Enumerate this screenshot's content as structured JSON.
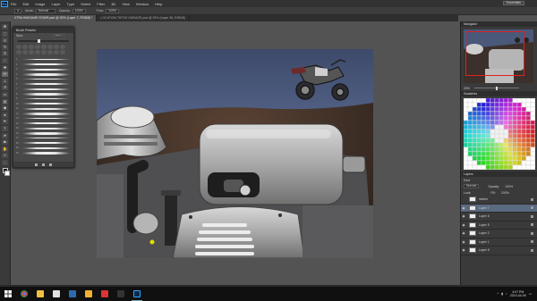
{
  "app": {
    "logo_text": "Ps"
  },
  "menu": [
    "File",
    "Edit",
    "Image",
    "Layer",
    "Type",
    "Select",
    "Filter",
    "3D",
    "View",
    "Window",
    "Help"
  ],
  "workspace_button": "Essentials",
  "options": {
    "mode_label": "Mode:",
    "mode_value": "Normal",
    "opacity_label": "Opacity:",
    "opacity_value": "100%",
    "flow_label": "Flow:",
    "flow_value": "100%"
  },
  "tabs": [
    {
      "label": "XTRA INHGAME ROWR.psd @ 33% (Layer 7, RGB/8) *",
      "active": true
    },
    {
      "label": "LOCATION TATOO GARAGE.psd @ 33% (Layer 36, RGB/8)",
      "active": false
    }
  ],
  "tools": [
    "move-icon",
    "marquee-icon",
    "lasso-icon",
    "quick-select-icon",
    "crop-icon",
    "eyedropper-icon",
    "spot-heal-icon",
    "brush-icon",
    "clone-stamp-icon",
    "history-brush-icon",
    "eraser-icon",
    "gradient-icon",
    "blur-icon",
    "dodge-icon",
    "pen-icon",
    "type-icon",
    "path-select-icon",
    "rectangle-icon",
    "hand-icon",
    "zoom-icon",
    "more-icon"
  ],
  "brush_panel": {
    "title": "Brush Presets",
    "size_label": "Size:",
    "size_value": "400 px",
    "stroke_numbers": [
      "1",
      "2",
      "3",
      "4",
      "5",
      "6",
      "7",
      "8",
      "9",
      "10",
      "11",
      "12",
      "13",
      "14",
      "15",
      "16",
      "17",
      "18",
      "19",
      "20",
      "21",
      "22",
      "23",
      "24"
    ]
  },
  "navigator": {
    "title": "Navigator",
    "zoom": "33%"
  },
  "swatches": {
    "title": "Swatches"
  },
  "layers": {
    "title": "Layers",
    "kind_label": "Kind",
    "blend": "Normal",
    "opacity_label": "Opacity:",
    "opacity_value": "100%",
    "lock_label": "Lock:",
    "fill_label": "Fill:",
    "fill_value": "100%",
    "rows": [
      {
        "name": "sketch",
        "visible": false,
        "selected": false
      },
      {
        "name": "Layer 7",
        "visible": true,
        "selected": true
      },
      {
        "name": "Layer 6",
        "visible": true,
        "selected": false
      },
      {
        "name": "Layer 5",
        "visible": true,
        "selected": false
      },
      {
        "name": "Layer 2",
        "visible": true,
        "selected": false
      },
      {
        "name": "Layer 1",
        "visible": true,
        "selected": false
      },
      {
        "name": "Layer 8",
        "visible": true,
        "selected": false
      }
    ]
  },
  "taskbar": {
    "apps": [
      "chrome-icon",
      "file-explorer-icon",
      "media-player-icon",
      "store-icon",
      "folder-icon",
      "app-red-icon",
      "app-dark-icon",
      "photoshop-icon"
    ],
    "time": "4:07 PM",
    "date": "2019-04-09"
  }
}
